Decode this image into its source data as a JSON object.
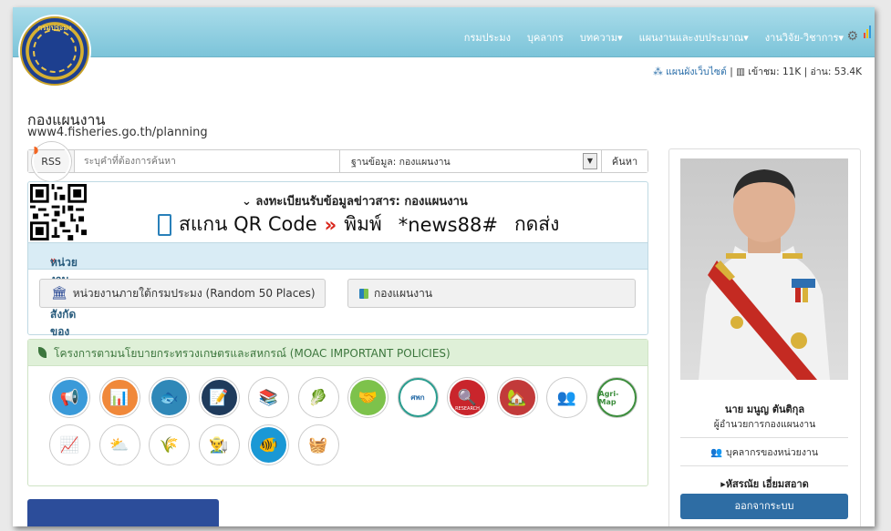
{
  "logo": {
    "text": "กรมประมง"
  },
  "nav": [
    {
      "label": "กรมประมง"
    },
    {
      "label": "บุคลากร"
    },
    {
      "label": "บทความ",
      "caret": "▾"
    },
    {
      "label": "แผนงานและงบประมาณ",
      "caret": "▾"
    },
    {
      "label": "งานวิจัย-วิชาการ",
      "caret": "▾"
    }
  ],
  "stats": {
    "sitemap": "แผนผังเว็บไซต์",
    "sep": "|",
    "visits": "เข้าชม: 11K",
    "reads": "อ่าน: 53.4K"
  },
  "page": {
    "title": "กองแผนงาน",
    "url": "www4.fisheries.go.th/planning"
  },
  "search": {
    "rss": "RSS",
    "placeholder": "ระบุคำที่ต้องการค้นหา",
    "database": "ฐานข้อมูล: กองแผนงาน",
    "button": "ค้นหา"
  },
  "register": {
    "heading": "ลงทะเบียนรับข้อมูลข่าวสาร: กองแผนงาน",
    "scan": "สแกน QR Code",
    "print": "พิมพ์",
    "code": "*news88#",
    "send": "กดส่ง"
  },
  "units": {
    "heading": "หน่วยงานในสังกัดของเรา",
    "random": "หน่วยงานภายใต้กรมประมง (Random 50 Places)",
    "planning": "กองแผนงาน"
  },
  "policies": {
    "heading": "โครงการตามนโยบายกระทรวงเกษตรและสหกรณ์ (MOAC IMPORTANT POLICIES)",
    "icons": [
      {
        "name": "megaphone-icon",
        "color": "#3a9ad9"
      },
      {
        "name": "growth-chart-icon",
        "color": "#f0883a"
      },
      {
        "name": "fish-farm-icon",
        "color": "#2f88b8"
      },
      {
        "name": "document-icon",
        "color": "#1f3b5c"
      },
      {
        "name": "learning-center-icon",
        "color": "#ffffff"
      },
      {
        "name": "produce-icon",
        "color": "#ffffff"
      },
      {
        "name": "handshake-icon",
        "color": "#7dc24b"
      },
      {
        "name": "cooperative-icon",
        "color": "#ffffff"
      },
      {
        "name": "research-icon",
        "color": "#c9252c"
      },
      {
        "name": "farm-land-icon",
        "color": "#c23a3a"
      },
      {
        "name": "farmers-icon",
        "color": "#ffffff"
      },
      {
        "name": "agri-map-icon",
        "color": "#ffffff"
      },
      {
        "name": "presentation-icon",
        "color": "#ffffff"
      },
      {
        "name": "weather-icon",
        "color": "#ffffff"
      },
      {
        "name": "field-icon",
        "color": "#ffffff"
      },
      {
        "name": "farmer-icon",
        "color": "#ffffff"
      },
      {
        "name": "fish-icon",
        "color": "#1a98d5"
      },
      {
        "name": "market-icon",
        "color": "#ffffff"
      }
    ],
    "agri_map_label": "Agri-Map",
    "research_label": "RESEARCH",
    "cooperative_label": "ศพก"
  },
  "profile": {
    "name": "นาย มนูญ ตันติกุล",
    "position": "ผู้อำนวยการกองแผนงาน",
    "staff": "บุคลากรของหน่วยงาน",
    "user": "▸หัสรณัย เอี่ยมสอาด",
    "logout": "ออกจากระบบ"
  }
}
